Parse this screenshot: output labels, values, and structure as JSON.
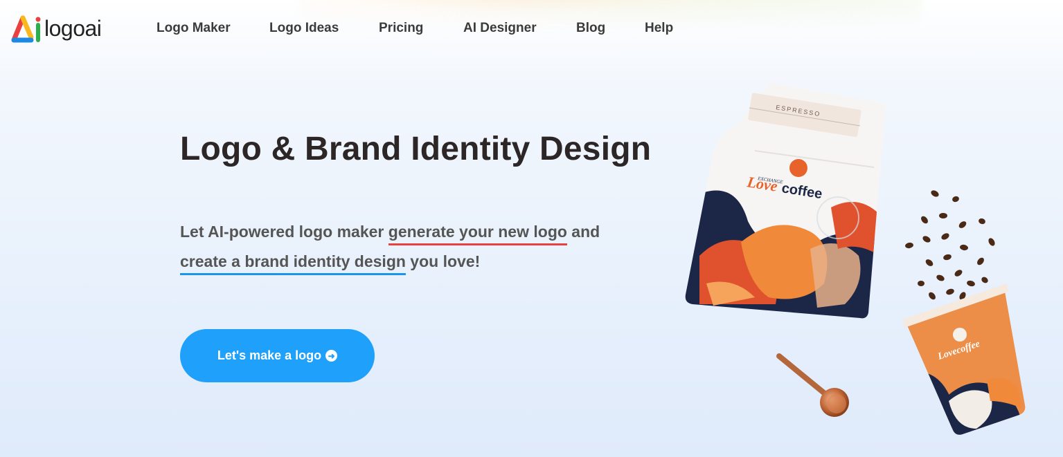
{
  "brand": {
    "name": "logoai"
  },
  "nav": {
    "items": [
      {
        "label": "Logo Maker"
      },
      {
        "label": "Logo Ideas"
      },
      {
        "label": "Pricing"
      },
      {
        "label": "AI Designer"
      },
      {
        "label": "Blog"
      },
      {
        "label": "Help"
      }
    ]
  },
  "hero": {
    "title": "Logo & Brand Identity Design",
    "sub_part1": "Let AI-powered logo maker ",
    "sub_highlight1": "generate your new logo",
    "sub_part2": " and ",
    "sub_highlight2": "create a brand identity design",
    "sub_part3": " you love!",
    "cta_label": "Let's make a logo",
    "cta_icon": "arrow-circle-right-icon"
  },
  "illustration": {
    "bag_label_top": "ESPRESSO",
    "bag_brand_small": "EXCHANGE",
    "bag_brand_love": "Love",
    "bag_brand_coffee": "coffee",
    "cup_brand": "Lovecoffee"
  },
  "colors": {
    "accent": "#1ea0fb",
    "underline_red": "#e8413f",
    "underline_blue": "#1b95ec",
    "title": "#2d2627"
  }
}
